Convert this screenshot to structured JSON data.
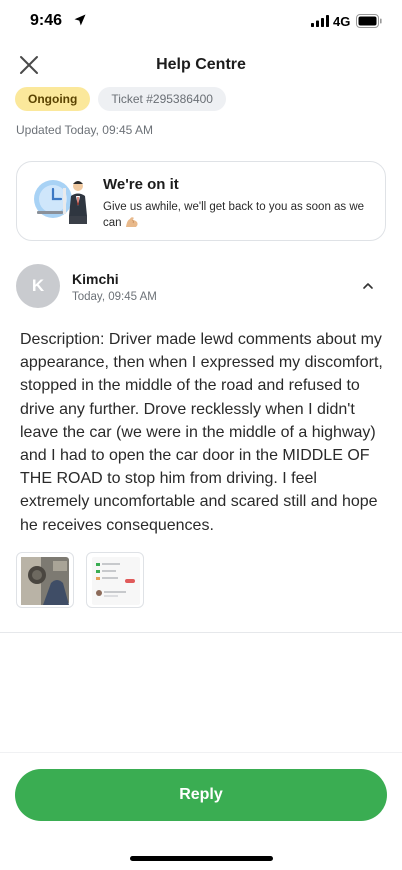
{
  "status_bar": {
    "time": "9:46",
    "network": "4G",
    "icons": [
      "location-arrow-icon",
      "signal-bars-icon",
      "battery-icon"
    ]
  },
  "header": {
    "title": "Help Centre",
    "close_icon": "close-icon"
  },
  "ticket": {
    "status": "Ongoing",
    "status_color": "#fbe89b",
    "ticket_label": "Ticket #295386400",
    "updated": "Updated Today, 09:45 AM"
  },
  "info_card": {
    "title": "We're on it",
    "body": "Give us awhile, we'll get back to you as soon as we can",
    "emoji": "flexed-biceps-emoji",
    "illustration": "agent-with-clock-illustration"
  },
  "message": {
    "avatar_initial": "K",
    "author": "Kimchi",
    "time": "Today, 09:45 AM",
    "collapse_icon": "chevron-up-icon",
    "description": "Description: Driver made lewd comments about my appearance, then when I expressed my discomfort, stopped in the middle of the road and refused to drive any further. Drove recklessly when I didn't leave the car (we were in the middle of a highway) and I had to open the car door in the MIDDLE OF THE ROAD to stop him from driving. I feel extremely uncomfortable and scared still and hope he receives consequences.",
    "attachments": [
      "photo-attachment",
      "screenshot-attachment"
    ]
  },
  "reply": {
    "label": "Reply",
    "color": "#3aad52"
  }
}
